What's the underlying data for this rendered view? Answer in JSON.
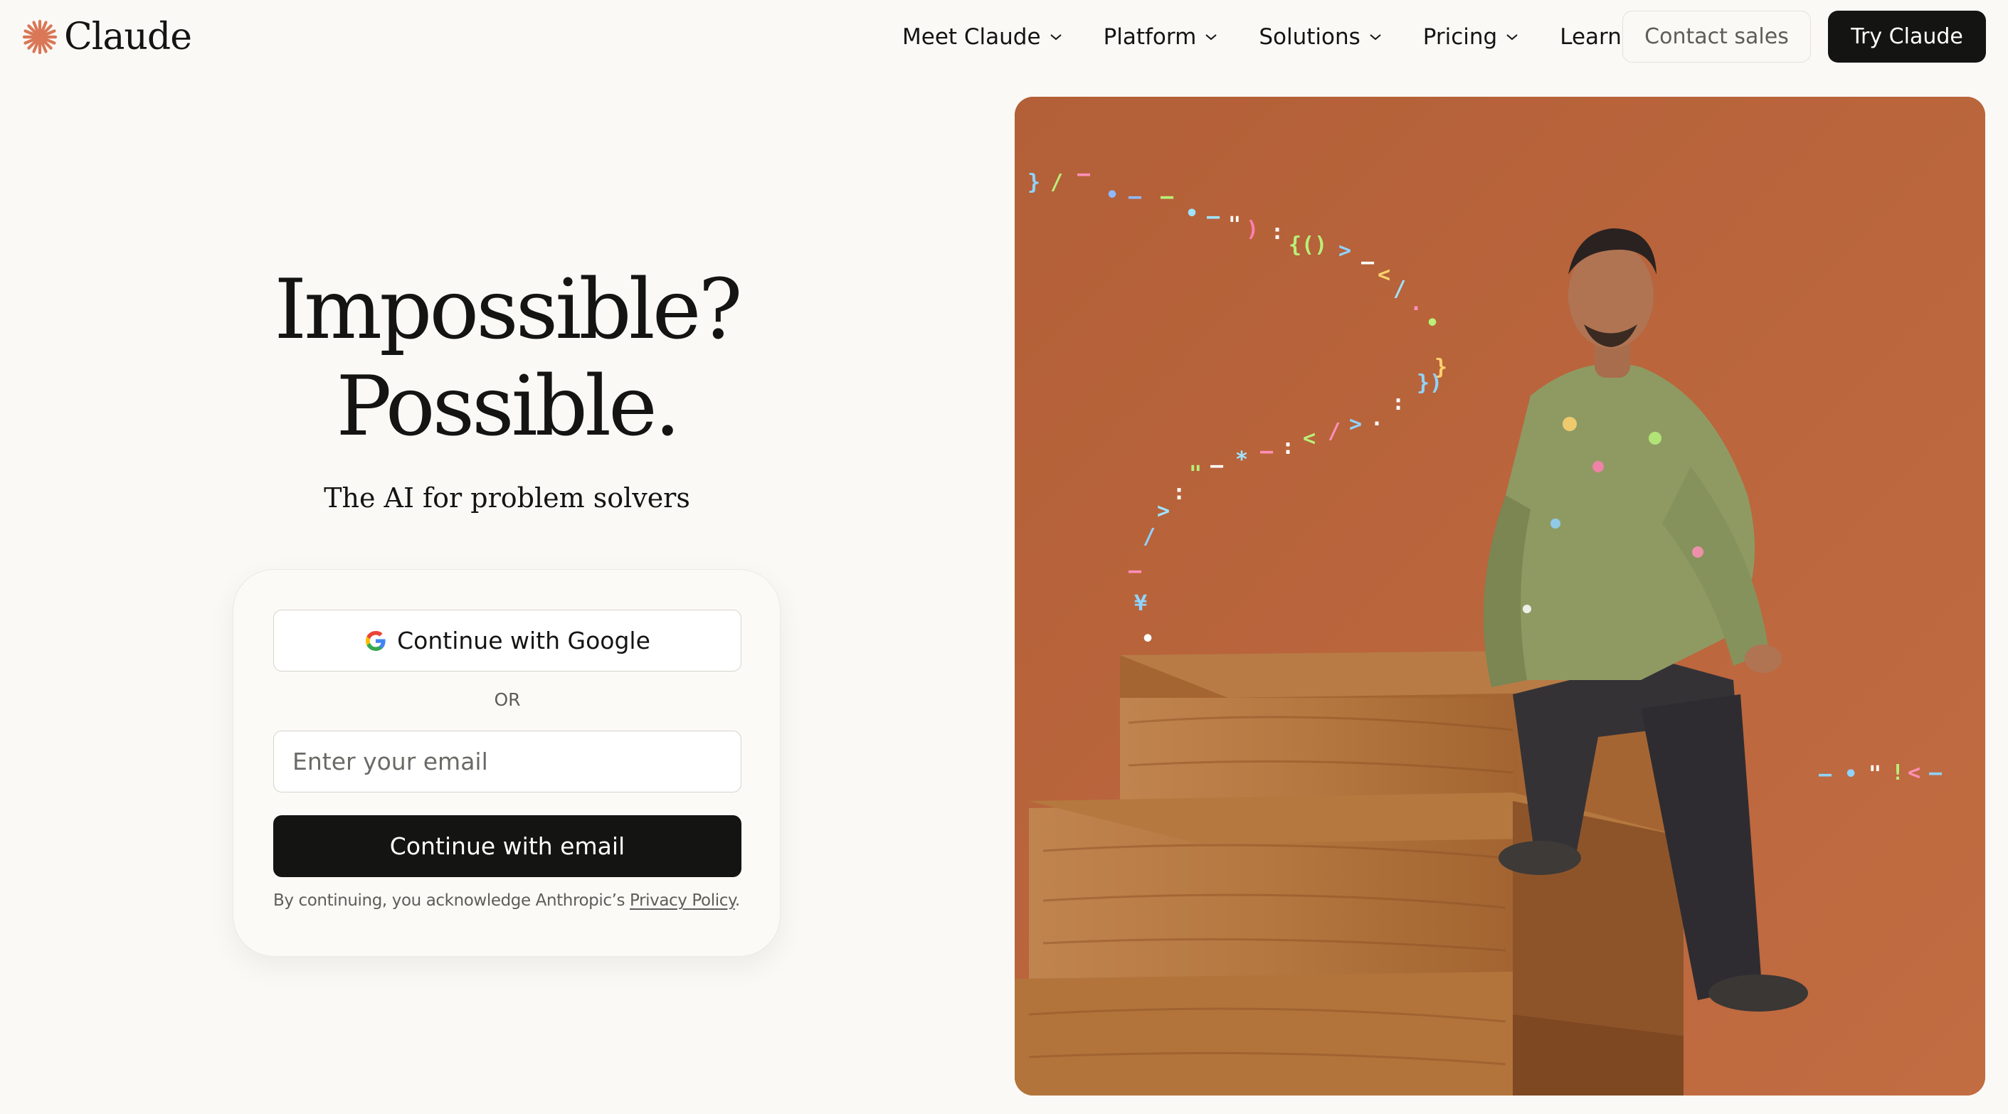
{
  "brand": {
    "name": "Claude",
    "accent": "#d97757"
  },
  "nav": {
    "items": [
      {
        "label": "Meet Claude"
      },
      {
        "label": "Platform"
      },
      {
        "label": "Solutions"
      },
      {
        "label": "Pricing"
      },
      {
        "label": "Learn"
      }
    ],
    "contact_label": "Contact sales",
    "try_label": "Try Claude"
  },
  "hero": {
    "title_line1": "Impossible?",
    "title_line2": "Possible.",
    "subtitle": "The AI for problem solvers"
  },
  "signin": {
    "google_label": "Continue with Google",
    "or_label": "OR",
    "email_placeholder": "Enter your email",
    "email_value": "",
    "continue_email_label": "Continue with email",
    "legal_prefix": "By continuing, you acknowledge Anthropic’s ",
    "privacy_link": "Privacy Policy",
    "legal_suffix": "."
  },
  "icons": {
    "logo": "claude-starburst-icon",
    "dropdown": "chevron-down-icon",
    "google": "google-g-icon"
  },
  "colors": {
    "background": "#faf9f5",
    "primary_button": "#141413",
    "image_backdrop": "#b9653a"
  }
}
